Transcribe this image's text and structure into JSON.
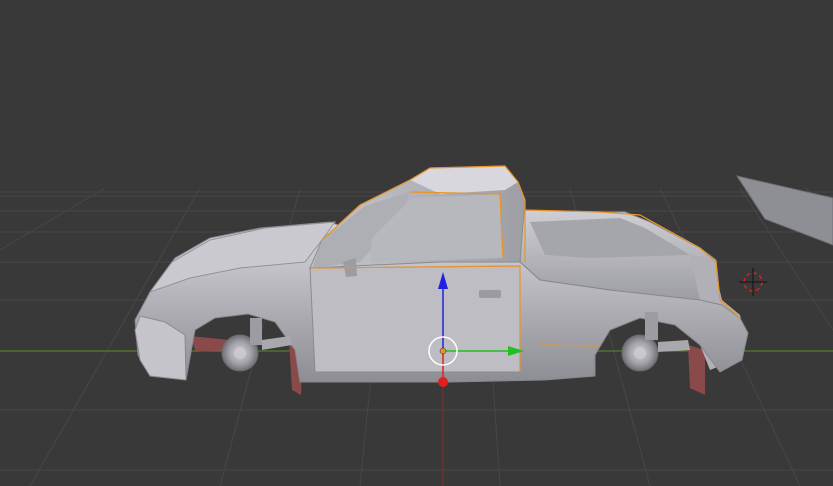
{
  "viewport": {
    "background": "#393939",
    "grid_color": "#474747",
    "x_axis_color": "#6b8e23",
    "y_axis_color": "#8b2a2a"
  },
  "model": {
    "body_color": "#b7b7bd",
    "body_shadow": "#8e8e95",
    "body_highlight": "#dadae0",
    "selection_outline": "#e8942a",
    "wheel_color": "#a5a5aa",
    "mudflap_color": "#8a4a4a"
  },
  "gizmo": {
    "z_color": "#2020e0",
    "y_color": "#20c020",
    "x_color": "#e02020",
    "origin_color": "#e8942a"
  },
  "cursor_3d": {
    "ring_color": "#e02020",
    "cross_color": "#111111"
  },
  "icons": [
    "translate-gizmo-icon",
    "3d-cursor-icon"
  ]
}
